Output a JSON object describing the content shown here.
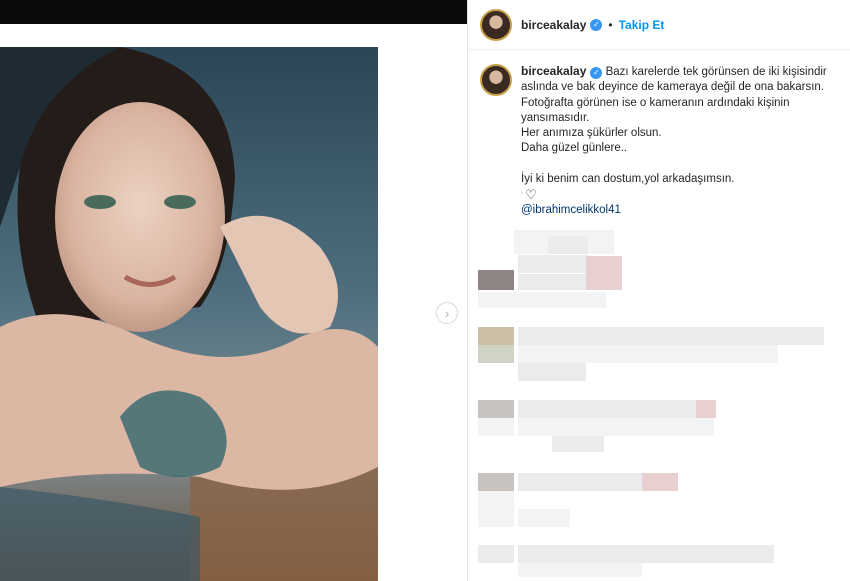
{
  "post": {
    "username": "birceakalay",
    "verified_glyph": "✓",
    "separator": "•",
    "follow_label": "Takip Et",
    "next_icon": "chevron-right",
    "caption": {
      "lines": [
        "Bazı karelerde tek görünsen de iki kişisindir",
        "aslında ve bak deyince de kameraya değil de ona bakarsın.",
        "Fotoğrafta görünen ise o kameranın ardındaki kişinin",
        "yansımasıdır.",
        "Her anımıza şükürler olsun.",
        "Daha güzel günlere..",
        "İyi ki benim can dostum,yol arkadaşımsın."
      ],
      "heart": "♡",
      "mention": "@ibrahimcelikkol41"
    }
  },
  "colors": {
    "verified": "#3897f0",
    "follow": "#0095f6",
    "avatar_ring": "#c9a24a",
    "mention": "#00376b"
  }
}
